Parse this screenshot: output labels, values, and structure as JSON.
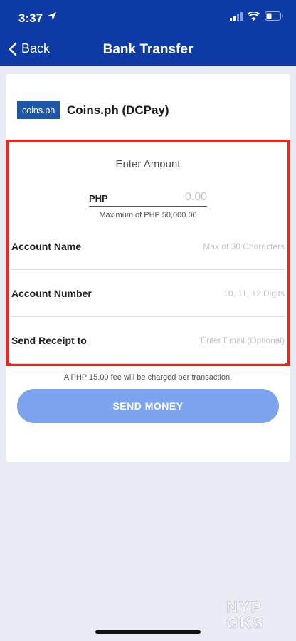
{
  "status_bar": {
    "time": "3:37"
  },
  "header": {
    "back_label": "Back",
    "title": "Bank Transfer"
  },
  "bank": {
    "logo_text": "coins.ph",
    "name": "Coins.ph (DCPay)"
  },
  "amount": {
    "heading": "Enter Amount",
    "currency": "PHP",
    "placeholder": "0.00",
    "max_note": "Maximum of PHP 50,000.00"
  },
  "fields": {
    "account_name": {
      "label": "Account Name",
      "placeholder": "Max of 30 Characters"
    },
    "account_number": {
      "label": "Account Number",
      "placeholder": "10, 11, 12 Digits"
    },
    "receipt": {
      "label": "Send Receipt to",
      "placeholder": "Enter Email (Optional)"
    }
  },
  "fee_note": "A PHP 15.00 fee will be charged per transaction.",
  "send_button": "SEND MONEY",
  "watermark": {
    "line1": "NYP",
    "line2": "GKS"
  },
  "colors": {
    "header_bg": "#0e3aa6",
    "highlight_border": "#e8281f",
    "send_button_bg": "#7ea3ee",
    "logo_bg": "#1f57a8"
  }
}
